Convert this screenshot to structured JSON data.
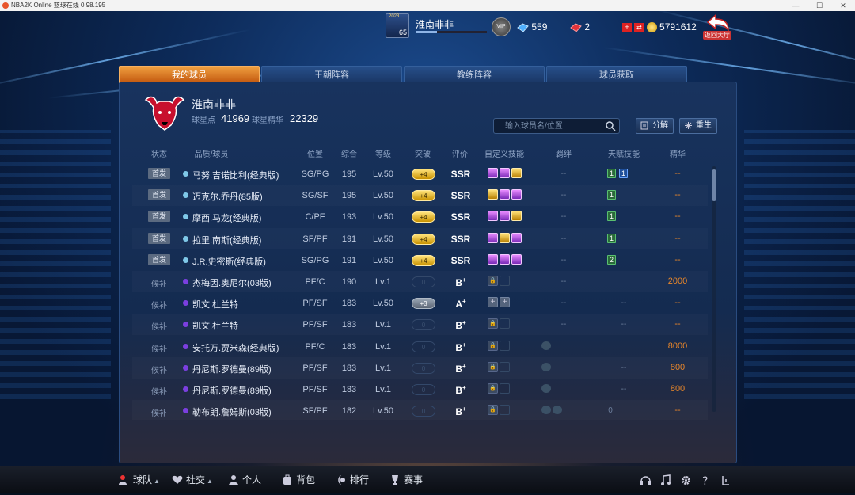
{
  "window": {
    "title": "NBA2K Online 篮球在线 0.98.195"
  },
  "topbar": {
    "year": "2023",
    "level": "65",
    "name": "淮南非非",
    "currency1": "559",
    "currency2": "2",
    "gold": "5791612",
    "back_label": "返回大厅",
    "vip_label": "VIP"
  },
  "tabs": [
    {
      "label": "我的球员"
    },
    {
      "label": "王朝阵容"
    },
    {
      "label": "教练阵容"
    },
    {
      "label": "球员获取"
    }
  ],
  "profile": {
    "name": "淮南非非",
    "points_label": "球星点",
    "points": "41969",
    "essence_label": "球星精华",
    "essence": "22329"
  },
  "search": {
    "placeholder": "输入球员名/位置"
  },
  "actions": {
    "decompose": "分解",
    "rebirth": "重生"
  },
  "columns": [
    "状态",
    "品质/球员",
    "位置",
    "综合",
    "等级",
    "突破",
    "评价",
    "自定义技能",
    "羁绊",
    "天赋技能",
    "精华"
  ],
  "rows": [
    {
      "status": "首发",
      "starter": true,
      "quality": "#7fc8e8",
      "name": "马努.吉诺比利(经典版)",
      "pos": "SG/PG",
      "ovr": "195",
      "lv": "Lv.50",
      "brk": "+4",
      "brkType": "gold",
      "rate": "SSR",
      "rsup": "",
      "skills": [
        "purple",
        "purple",
        "gold"
      ],
      "fetter": "--",
      "talents": [
        [
          "1",
          "g"
        ],
        [
          "1",
          "b"
        ]
      ],
      "ess": "--"
    },
    {
      "status": "首发",
      "starter": true,
      "quality": "#7fc8e8",
      "name": "迈克尔.乔丹(85版)",
      "pos": "SG/SF",
      "ovr": "195",
      "lv": "Lv.50",
      "brk": "+4",
      "brkType": "gold",
      "rate": "SSR",
      "rsup": "",
      "skills": [
        "gold",
        "purple",
        "purple"
      ],
      "fetter": "--",
      "talents": [
        [
          "1",
          "g"
        ]
      ],
      "ess": "--"
    },
    {
      "status": "首发",
      "starter": true,
      "quality": "#7fc8e8",
      "name": "摩西.马龙(经典版)",
      "pos": "C/PF",
      "ovr": "193",
      "lv": "Lv.50",
      "brk": "+4",
      "brkType": "gold",
      "rate": "SSR",
      "rsup": "",
      "skills": [
        "purple",
        "purple",
        "gold"
      ],
      "fetter": "--",
      "talents": [
        [
          "1",
          "g"
        ]
      ],
      "ess": "--"
    },
    {
      "status": "首发",
      "starter": true,
      "quality": "#7fc8e8",
      "name": "拉里.南斯(经典版)",
      "pos": "SF/PF",
      "ovr": "191",
      "lv": "Lv.50",
      "brk": "+4",
      "brkType": "gold",
      "rate": "SSR",
      "rsup": "",
      "skills": [
        "purple",
        "gold",
        "purple"
      ],
      "fetter": "--",
      "talents": [
        [
          "1",
          "g"
        ]
      ],
      "ess": "--"
    },
    {
      "status": "首发",
      "starter": true,
      "quality": "#7fc8e8",
      "name": "J.R.史密斯(经典版)",
      "pos": "SG/PG",
      "ovr": "191",
      "lv": "Lv.50",
      "brk": "+4",
      "brkType": "gold",
      "rate": "SSR",
      "rsup": "",
      "skills": [
        "purple",
        "purple",
        "purple"
      ],
      "fetter": "--",
      "talents": [
        [
          "2",
          "g"
        ]
      ],
      "ess": "--"
    },
    {
      "status": "候补",
      "starter": false,
      "quality": "#7b3fe0",
      "name": "杰梅因.奥尼尔(03版)",
      "pos": "PF/C",
      "ovr": "190",
      "lv": "Lv.1",
      "brk": "0",
      "brkType": "empty",
      "rate": "B",
      "rsup": "+",
      "skills": [
        "lock",
        "empty"
      ],
      "fetter": "--",
      "talents": [],
      "ess": "2000"
    },
    {
      "status": "候补",
      "starter": false,
      "quality": "#7b3fe0",
      "name": "凯文.杜兰特",
      "pos": "PF/SF",
      "ovr": "183",
      "lv": "Lv.50",
      "brk": "+3",
      "brkType": "gray",
      "rate": "A",
      "rsup": "+",
      "skills": [
        "plus",
        "plus"
      ],
      "fetter": "--",
      "talents": [],
      "talentDash": "--",
      "ess": "--"
    },
    {
      "status": "候补",
      "starter": false,
      "quality": "#7b3fe0",
      "name": "凯文.杜兰特",
      "pos": "PF/SF",
      "ovr": "183",
      "lv": "Lv.1",
      "brk": "0",
      "brkType": "empty",
      "rate": "B",
      "rsup": "+",
      "skills": [
        "lock",
        "empty"
      ],
      "fetter": "--",
      "talents": [],
      "talentDash": "--",
      "ess": "--"
    },
    {
      "status": "候补",
      "starter": false,
      "quality": "#7b3fe0",
      "name": "安托万.贾米森(经典版)",
      "pos": "PF/C",
      "ovr": "183",
      "lv": "Lv.1",
      "brk": "0",
      "brkType": "empty",
      "rate": "B",
      "rsup": "+",
      "skills": [
        "lock",
        "empty"
      ],
      "fetter": "icon",
      "talents": [],
      "ess": "8000"
    },
    {
      "status": "候补",
      "starter": false,
      "quality": "#7b3fe0",
      "name": "丹尼斯.罗德曼(89版)",
      "pos": "PF/SF",
      "ovr": "183",
      "lv": "Lv.1",
      "brk": "0",
      "brkType": "empty",
      "rate": "B",
      "rsup": "+",
      "skills": [
        "lock",
        "empty"
      ],
      "fetter": "icon",
      "talents": [],
      "talentDash": "--",
      "ess": "800"
    },
    {
      "status": "候补",
      "starter": false,
      "quality": "#7b3fe0",
      "name": "丹尼斯.罗德曼(89版)",
      "pos": "PF/SF",
      "ovr": "183",
      "lv": "Lv.1",
      "brk": "0",
      "brkType": "empty",
      "rate": "B",
      "rsup": "+",
      "skills": [
        "lock",
        "empty"
      ],
      "fetter": "icon",
      "talents": [],
      "talentDash": "--",
      "ess": "800"
    },
    {
      "status": "候补",
      "starter": false,
      "quality": "#7b3fe0",
      "name": "勒布朗.詹姆斯(03版)",
      "pos": "SF/PF",
      "ovr": "182",
      "lv": "Lv.50",
      "brk": "0",
      "brkType": "empty",
      "rate": "B",
      "rsup": "+",
      "skills": [
        "lock",
        "empty"
      ],
      "fetter": "icon2",
      "talents": [],
      "talentDash": "0",
      "ess": "--"
    }
  ],
  "bottomnav": [
    {
      "label": "球队",
      "caret": true
    },
    {
      "label": "社交",
      "caret": true
    },
    {
      "label": "个人"
    },
    {
      "label": "背包"
    },
    {
      "label": "排行"
    },
    {
      "label": "赛事"
    }
  ],
  "sysicons": [
    "headset-icon",
    "music-icon",
    "settings-icon",
    "help-icon",
    "exit-icon"
  ]
}
